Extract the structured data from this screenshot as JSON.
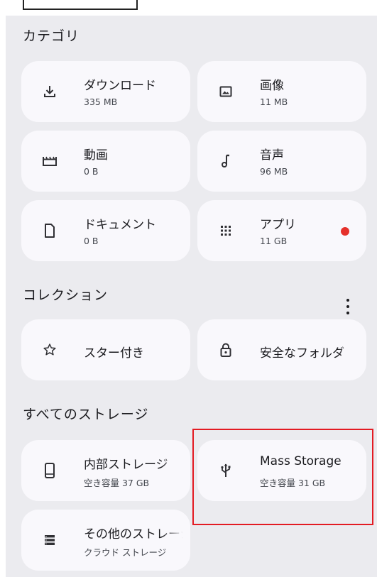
{
  "sections": {
    "categories": "カテゴリ",
    "collections": "コレクション",
    "storage": "すべてのストレージ"
  },
  "categories": [
    {
      "name": "ダウンロード",
      "size": "335 MB",
      "icon": "download-icon"
    },
    {
      "name": "画像",
      "size": "11 MB",
      "icon": "image-icon"
    },
    {
      "name": "動画",
      "size": "0 B",
      "icon": "video-icon"
    },
    {
      "name": "音声",
      "size": "96 MB",
      "icon": "music-note-icon"
    },
    {
      "name": "ドキュメント",
      "size": "0 B",
      "icon": "document-icon"
    },
    {
      "name": "アプリ",
      "size": "11 GB",
      "icon": "apps-grid-icon",
      "badge_color": "#e5302b"
    }
  ],
  "collections": [
    {
      "name": "スター付き",
      "icon": "star-icon"
    },
    {
      "name": "安全なフォルダ",
      "icon": "lock-icon"
    }
  ],
  "storage": [
    {
      "name": "内部ストレージ",
      "detail": "空き容量 37 GB",
      "icon": "phone-icon"
    },
    {
      "name": "Mass Storage",
      "detail": "空き容量 31 GB",
      "icon": "usb-icon"
    },
    {
      "name": "その他のストレージ",
      "detail": "クラウド ストレージ",
      "icon": "storage-list-icon"
    }
  ],
  "colors": {
    "panel_background": "#ebebef",
    "card_background": "#f9f8fc",
    "highlight_border": "#e31b23",
    "badge": "#e5302b"
  }
}
